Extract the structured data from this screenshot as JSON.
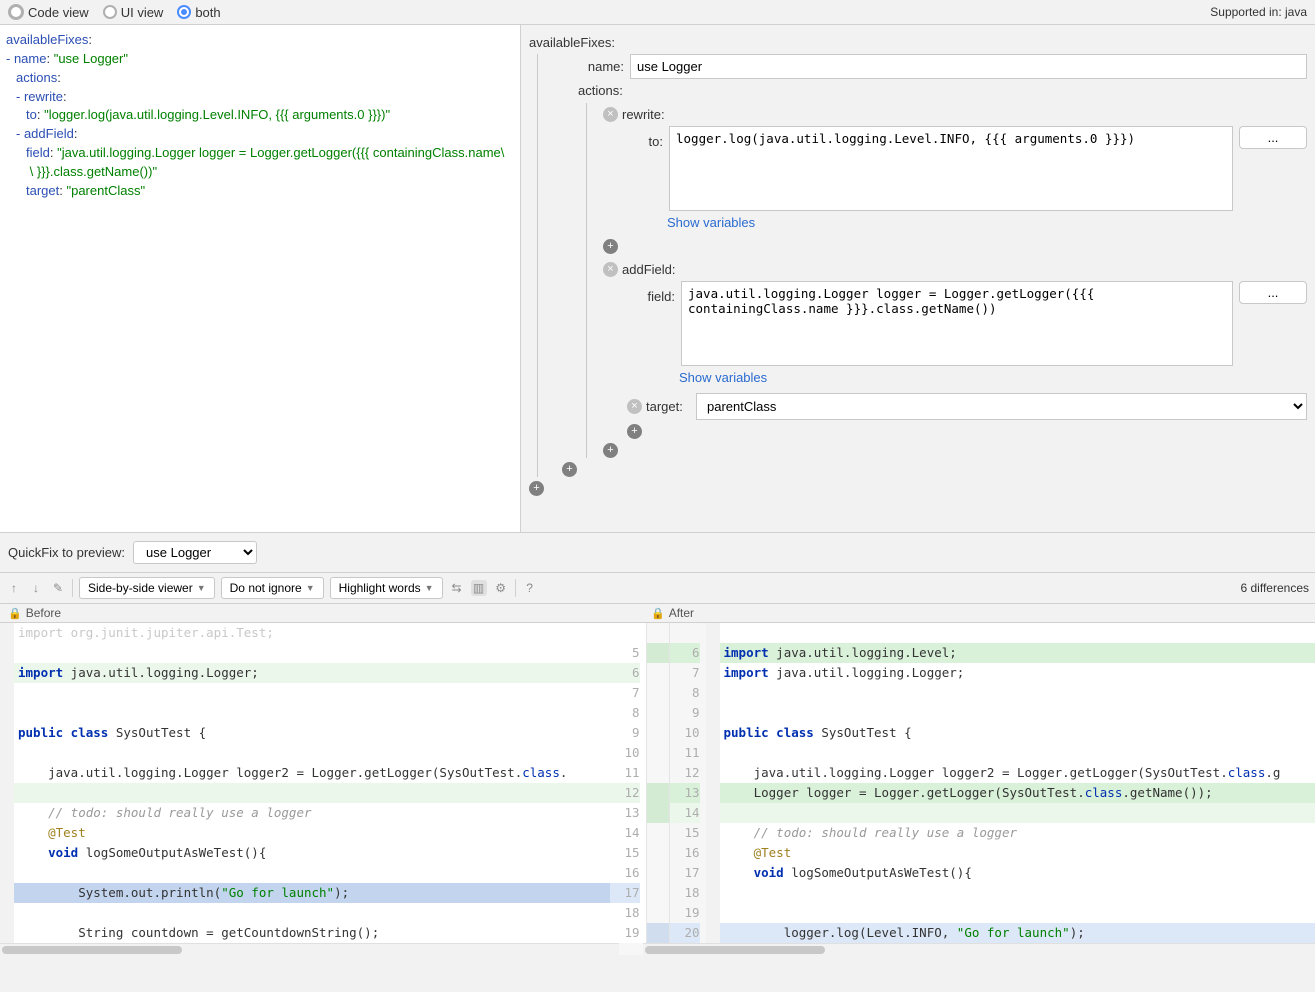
{
  "toolbar": {
    "code_view": "Code view",
    "ui_view": "UI view",
    "both": "both",
    "supported": "Supported in: java"
  },
  "left_code": {
    "l1_key": "availableFixes",
    "l2_key": "- name",
    "l2_val": "\"use Logger\"",
    "l3_key": "actions",
    "l4_key": "- rewrite",
    "l5_key": "to",
    "l5_val": "\"logger.log(java.util.logging.Level.INFO, {{{ arguments.0 }}})\"",
    "l6_key": "- addField",
    "l7_key": "field",
    "l7_val": "\"java.util.logging.Logger logger = Logger.getLogger({{{ containingClass.name\\",
    "l7b_val": " \\ }}}.class.getName())\"",
    "l8_key": "target",
    "l8_val": "\"parentClass\""
  },
  "tree": {
    "root": "availableFixes:",
    "name_label": "name:",
    "name_value": "use Logger",
    "actions_label": "actions:",
    "rewrite_label": "rewrite:",
    "to_label": "to:",
    "to_value": "logger.log(java.util.logging.Level.INFO, {{{ arguments.0 }}})",
    "show_vars": "Show variables",
    "addField_label": "addField:",
    "field_label": "field:",
    "field_value": "java.util.logging.Logger logger = Logger.getLogger({{{ containingClass.name }}}.class.getName())",
    "target_label": "target:",
    "target_value": "parentClass",
    "ellipsis": "..."
  },
  "preview": {
    "label": "QuickFix to preview:",
    "value": "use Logger"
  },
  "diff_toolbar": {
    "side_by_side": "Side-by-side viewer",
    "do_not_ignore": "Do not ignore",
    "highlight_words": "Highlight words",
    "differences": "6 differences"
  },
  "diff_header": {
    "before": "Before",
    "after": "After"
  },
  "before": {
    "lines": [
      {
        "n": "",
        "html": "<span class='dim'>import org.junit.jupiter.api.Test;</span>"
      },
      {
        "n": "",
        "html": ""
      },
      {
        "n": "",
        "html": "<span class='kw'>import</span> java.util.logging.Logger;",
        "cls": "addedlight"
      },
      {
        "n": "",
        "html": ""
      },
      {
        "n": "",
        "html": ""
      },
      {
        "n": "",
        "html": "<span class='kw'>public class</span> SysOutTest {"
      },
      {
        "n": "",
        "html": ""
      },
      {
        "n": "",
        "html": "    java.util.logging.Logger logger2 = Logger.getLogger(SysOutTest.<span class='hlcls'>class</span>."
      },
      {
        "n": "",
        "html": "",
        "cls": "addedlight"
      },
      {
        "n": "",
        "html": "    <span class='comment'>// todo: should really use a logger</span>"
      },
      {
        "n": "",
        "html": "    <span class='ann'>@Test</span>"
      },
      {
        "n": "",
        "html": "    <span class='kw'>void</span> logSomeOutputAsWeTest(){"
      },
      {
        "n": "",
        "html": ""
      },
      {
        "n": "",
        "html": "        System.out.println(<span class='strlit'>\"Go for launch\"</span>);",
        "cls": "modsel"
      },
      {
        "n": "",
        "html": ""
      },
      {
        "n": "",
        "html": "        String countdown = getCountdownString();"
      }
    ],
    "gutter": [
      "",
      "5",
      "6",
      "7",
      "8",
      "9",
      "10",
      "11",
      "12",
      "13",
      "14",
      "15",
      "16",
      "17",
      "18",
      "19"
    ]
  },
  "after": {
    "lines": [
      {
        "n": "",
        "html": ""
      },
      {
        "n": "6",
        "html": "<span class='kw'>import</span> java.util.logging.Level;",
        "cls": "added"
      },
      {
        "n": "7",
        "html": "<span class='kw'>import</span> java.util.logging.Logger;"
      },
      {
        "n": "8",
        "html": ""
      },
      {
        "n": "9",
        "html": ""
      },
      {
        "n": "10",
        "html": "<span class='kw'>public class</span> SysOutTest {"
      },
      {
        "n": "11",
        "html": ""
      },
      {
        "n": "12",
        "html": "    java.util.logging.Logger logger2 = Logger.getLogger(SysOutTest.<span class='hlcls'>class</span>.g"
      },
      {
        "n": "13",
        "html": "    Logger logger = Logger.getLogger(SysOutTest.<span class='hlcls'>class</span>.getName());",
        "cls": "added"
      },
      {
        "n": "14",
        "html": "",
        "cls": "addedlight"
      },
      {
        "n": "15",
        "html": "    <span class='comment'>// todo: should really use a logger</span>"
      },
      {
        "n": "16",
        "html": "    <span class='ann'>@Test</span>"
      },
      {
        "n": "17",
        "html": "    <span class='kw'>void</span> logSomeOutputAsWeTest(){"
      },
      {
        "n": "18",
        "html": ""
      },
      {
        "n": "19",
        "html": ""
      },
      {
        "n": "20",
        "html": "        logger.log(Level.INFO, <span class='strlit'>\"Go for launch\"</span>);",
        "cls": "mod"
      }
    ],
    "gutter": [
      "",
      "6",
      "7",
      "8",
      "9",
      "10",
      "11",
      "12",
      "13",
      "14",
      "15",
      "16",
      "17",
      "18",
      "19",
      "20"
    ]
  },
  "center": [
    "",
    "added",
    "",
    "",
    "",
    "",
    "",
    "",
    "added",
    "added",
    "",
    "",
    "",
    "",
    "",
    "mod"
  ]
}
